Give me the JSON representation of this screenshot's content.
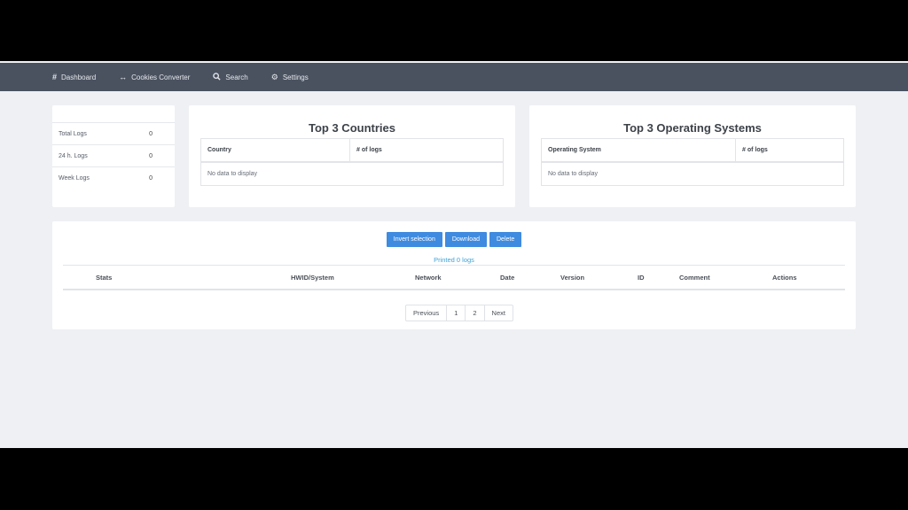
{
  "nav": {
    "items": [
      {
        "icon": "#",
        "label": "Dashboard"
      },
      {
        "icon": "↔",
        "label": "Cookies Converter"
      },
      {
        "icon": "🔍",
        "label": "Search"
      },
      {
        "icon": "⚙",
        "label": "Settings"
      }
    ]
  },
  "stats": {
    "rows": [
      {
        "label": "Total Logs",
        "value": "0"
      },
      {
        "label": "24 h. Logs",
        "value": "0"
      },
      {
        "label": "Week Logs",
        "value": "0"
      }
    ]
  },
  "countries": {
    "title": "Top 3 Countries",
    "col1": "Country",
    "col2": "# of logs",
    "empty": "No data to display"
  },
  "os": {
    "title": "Top 3 Operating Systems",
    "col1": "Operating System",
    "col2": "# of logs",
    "empty": "No data to display"
  },
  "logs": {
    "buttons": {
      "invert": "Invert selection",
      "download": "Download",
      "delete": "Delete"
    },
    "printed": "Printed 0 logs",
    "columns": [
      "Stats",
      "HWID/System",
      "Network",
      "Date",
      "Version",
      "ID",
      "Comment",
      "Actions"
    ],
    "pager": {
      "previous": "Previous",
      "page1": "1",
      "page2": "2",
      "next": "Next"
    }
  },
  "colors": {
    "navbar": "#4a5260",
    "button": "#3f8be0",
    "link": "#3fa3d8",
    "background": "#eef0f3"
  }
}
